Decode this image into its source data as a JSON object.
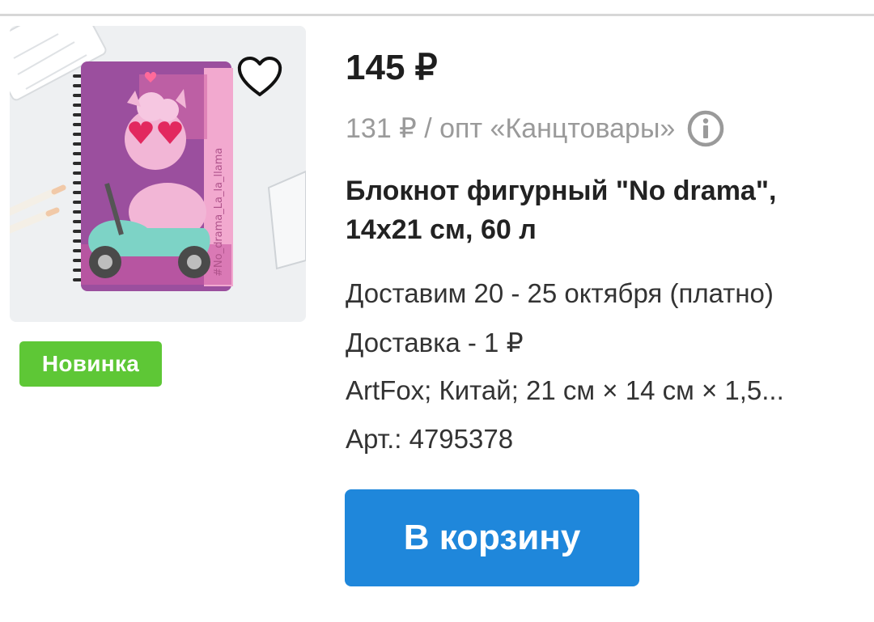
{
  "product": {
    "price": "145 ₽",
    "wholesale": "131 ₽ / опт «Канцтовары»",
    "title": "Блокнот фигурный \"No drama\", 14х21 см, 60 л",
    "delivery_dates": "Доставим 20 - 25 октября (платно)",
    "delivery_cost": "Доставка - 1 ₽",
    "specs": "ArtFox; Китай; 21 см × 14 см × 1,5...",
    "article": "Арт.: 4795378",
    "badge": "Новинка",
    "cart_button": "В корзину",
    "image_text": "#No_drama_La_la_llama"
  },
  "icons": {
    "favorite": "heart-outline-icon",
    "info": "info-circle-icon"
  },
  "colors": {
    "badge_bg": "#5ec736",
    "cart_bg": "#1f87db",
    "secondary_text": "#9a9a9a"
  }
}
